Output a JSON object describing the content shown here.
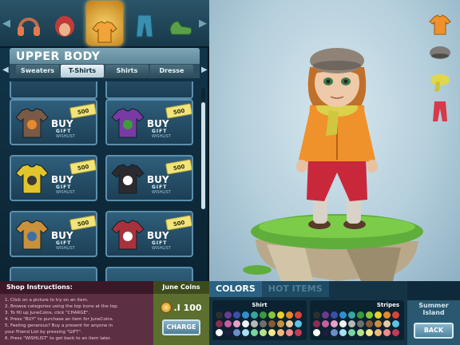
{
  "header": {
    "section_title": "UPPER BODY",
    "categories": [
      {
        "icon": "headphones-icon"
      },
      {
        "icon": "hair-icon"
      },
      {
        "icon": "shirt-icon",
        "selected": true
      },
      {
        "icon": "pants-icon"
      },
      {
        "icon": "shoes-icon"
      }
    ],
    "subtabs": [
      "Sweaters",
      "T-Shirts",
      "Shirts",
      "Dresse"
    ],
    "active_subtab": "T-Shirts"
  },
  "item_card": {
    "buy_label": "BUY",
    "gift_label": "GIFT",
    "wishlist_label": "WISHLIST"
  },
  "items": [
    {
      "price": "500",
      "color": "#7a5a46",
      "accent": "#e58a2c"
    },
    {
      "price": "500",
      "color": "#7a3aa6",
      "accent": "#3e9d3a"
    },
    {
      "price": "500",
      "color": "#e2c52a",
      "accent": "#3a3a3a"
    },
    {
      "price": "500",
      "color": "#2b2b2f",
      "accent": "#ffffff"
    },
    {
      "price": "500",
      "color": "#c9913c",
      "accent": "#3c6fa8"
    },
    {
      "price": "500",
      "color": "#a8323c",
      "accent": "#ffffff"
    }
  ],
  "bottom": {
    "instructions_title": "Shop Instructions:",
    "instructions": [
      "1. Click on a picture to try on an item.",
      "2. Browse categories using the top icons at the top.",
      "3. To fill up JuneCoins, click \"CHARGE\".",
      "4. Press \"BUY\" to purchase an item for JuneCoins.",
      "5. Feeling generous? Buy a present for anyone in",
      "your Friend List by pressing \"GIFT\".",
      "6. Press \"WISHLIST\" to get back to an item later."
    ],
    "coins_title": "June Coins",
    "coins_value": ".I 100",
    "charge_label": "CHARGE",
    "tabs": [
      "COLORS",
      "HOT ITEMS"
    ],
    "active_tab": "COLORS",
    "palettes": [
      {
        "label": "Shirt"
      },
      {
        "label": "Stripes"
      }
    ],
    "location": "Summer Island",
    "back_label": "BACK"
  },
  "colors": {
    "swatches": [
      "#2f2f2f",
      "#6a3b8f",
      "#3a4fa8",
      "#2f8fd0",
      "#39a6a0",
      "#3b9a3c",
      "#8bc43a",
      "#e6d02c",
      "#e58a2c",
      "#d6443a",
      "#8c2d52",
      "#c65ea3",
      "#e9a0c6",
      "#f1f1f1",
      "#b9b9b9",
      "#6f6f6f",
      "#8a5a32",
      "#c9913c",
      "#e8c8a0",
      "#5bc3e8",
      "#ffffff",
      "#1d1d3d",
      "#6a8fcc",
      "#a8dff3",
      "#77d6a0",
      "#b7e08a",
      "#f6e88a",
      "#f4b67a",
      "#f08a8a",
      "#c23a5a"
    ],
    "panel_bg": "#143446",
    "accent": "#2b6283"
  }
}
